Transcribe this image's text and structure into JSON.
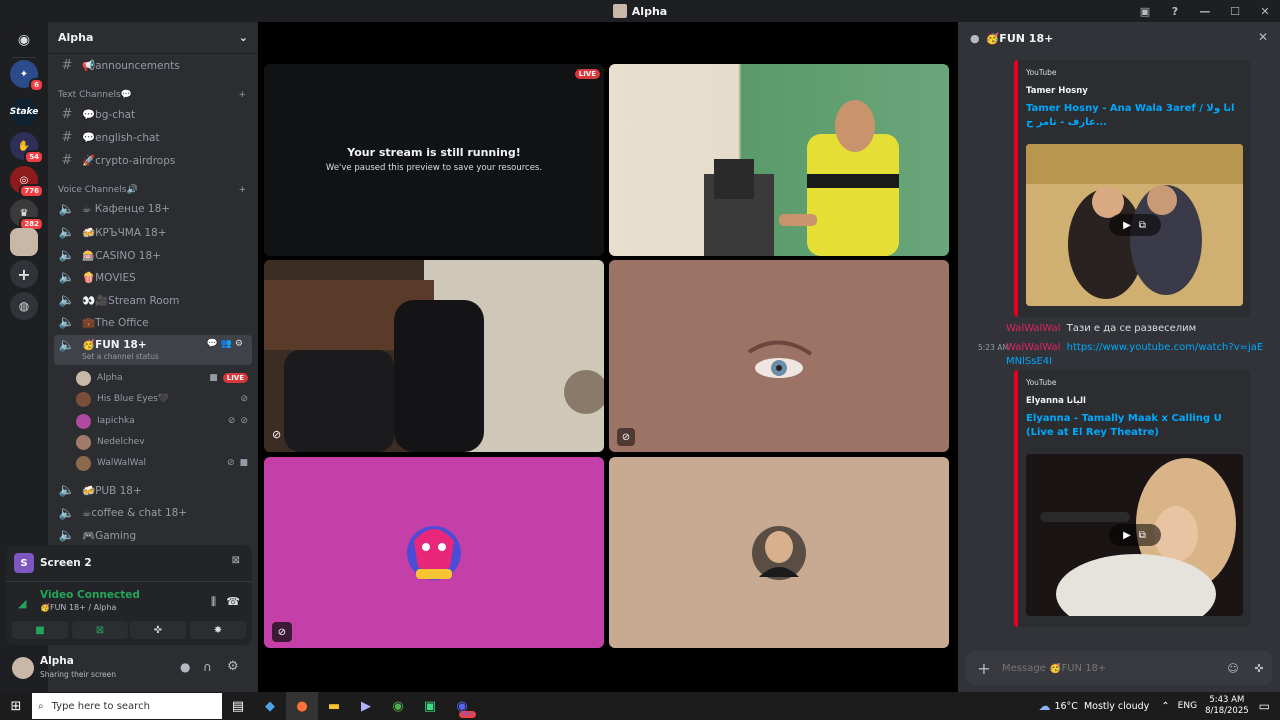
{
  "window": {
    "title": "Alpha"
  },
  "servers": {
    "badges": [
      "6",
      "54",
      "776",
      "282"
    ],
    "stake_label": "Stake"
  },
  "guild": {
    "name": "Alpha"
  },
  "channels": {
    "top": {
      "name": "📢announcements"
    },
    "text_category": "Text Channels💬",
    "text": [
      "💬bg-chat",
      "💬english-chat",
      "🚀crypto-airdrops"
    ],
    "voice_category": "Voice Channels🔊",
    "voice_before": [
      "☕ Кафенце 18+",
      "🍻КРЪЧМА 18+",
      "🎰CASINO 18+",
      "🍿MOVIES",
      "👀🎥Stream Room",
      "💼The Office"
    ],
    "active": {
      "name": "🥳FUN 18+",
      "status": "Set a channel status"
    },
    "voice_users": [
      {
        "name": "Alpha",
        "live": "LIVE"
      },
      {
        "name": "His Blue Eyes🖤"
      },
      {
        "name": "Iapichka"
      },
      {
        "name": "Nedelchev"
      },
      {
        "name": "WalWalWal"
      }
    ],
    "voice_after": [
      "🍻PUB 18+",
      "☕coffee & chat 18+",
      "🎮Gaming"
    ]
  },
  "voice_panel": {
    "screen_title": "Screen 2",
    "status": "Video Connected",
    "location": "🥳FUN 18+ / Alpha"
  },
  "user_panel": {
    "name": "Alpha",
    "status": "Sharing their screen"
  },
  "stage": {
    "live_badge": "LIVE",
    "paused_title": "Your stream is still running!",
    "paused_sub": "We've paused this preview to save your resources."
  },
  "chat": {
    "channel": "🥳FUN 18+",
    "embed1": {
      "provider": "YouTube",
      "author": "Tamer Hosny",
      "title": "Tamer Hosny - Ana Wala 3aref / انا ولا عارف - تامر ح..."
    },
    "messages": [
      {
        "author": "WalWalWal",
        "text": "Тази е да се развеселим",
        "time": ""
      },
      {
        "author": "WalWalWal",
        "text": "https://www.youtube.com/watch?v=jaEMNlSsE4I",
        "time": "5:23 AM"
      }
    ],
    "embed2": {
      "provider": "YouTube",
      "author": "Elyanna اليانا",
      "title": "Elyanna - Tamally Maak x Calling U (Live at El Rey Theatre)"
    },
    "input_placeholder": "Message 🥳FUN 18+"
  },
  "taskbar": {
    "search_placeholder": "Type here to search",
    "weather": "16°C  Mostly cloudy",
    "lang": "ENG",
    "time": "5:43 AM",
    "date": "8/18/2025",
    "notif": "99+"
  },
  "colors": {
    "accent": "#5865f2",
    "live": "#da373c",
    "link": "#00a8fc",
    "username": "#e0245e",
    "green": "#23a55a"
  }
}
